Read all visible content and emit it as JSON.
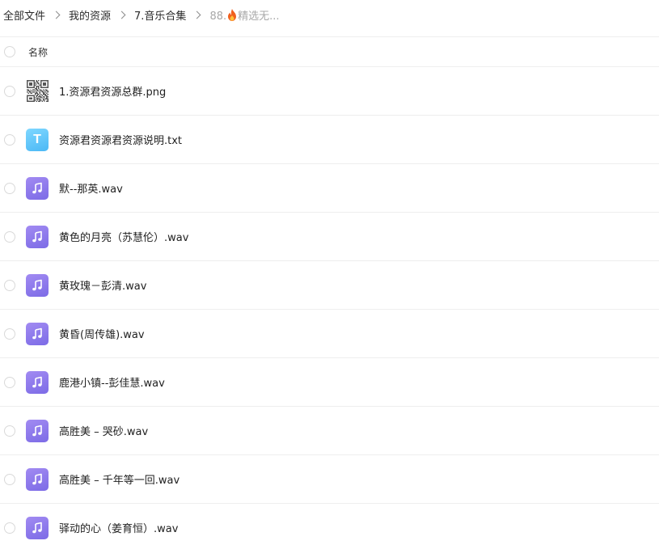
{
  "breadcrumb": {
    "items": [
      "全部文件",
      "我的资源",
      "7.音乐合集"
    ],
    "current_prefix": "88.",
    "current_suffix": "精选无..."
  },
  "header": {
    "name_label": "名称"
  },
  "files": [
    {
      "name": "1.资源君资源总群.png",
      "type": "image",
      "icon": "qr-code-icon"
    },
    {
      "name": "资源君资源君资源说明.txt",
      "type": "text",
      "icon": "text-file-icon",
      "glyph": "T"
    },
    {
      "name": "默--那英.wav",
      "type": "audio",
      "icon": "music-note-icon"
    },
    {
      "name": "黄色的月亮（苏慧伦）.wav",
      "type": "audio",
      "icon": "music-note-icon"
    },
    {
      "name": "黄玫瑰－彭清.wav",
      "type": "audio",
      "icon": "music-note-icon"
    },
    {
      "name": "黄昏(周传雄).wav",
      "type": "audio",
      "icon": "music-note-icon"
    },
    {
      "name": "鹿港小镇--彭佳慧.wav",
      "type": "audio",
      "icon": "music-note-icon"
    },
    {
      "name": "高胜美 – 哭砂.wav",
      "type": "audio",
      "icon": "music-note-icon"
    },
    {
      "name": "高胜美 – 千年等一回.wav",
      "type": "audio",
      "icon": "music-note-icon"
    },
    {
      "name": "驿动的心（姜育恒）.wav",
      "type": "audio",
      "icon": "music-note-icon"
    }
  ],
  "colors": {
    "audio_icon": "#8c79ec",
    "text_icon": "#5fc6fa",
    "divider": "#eeeeee"
  }
}
